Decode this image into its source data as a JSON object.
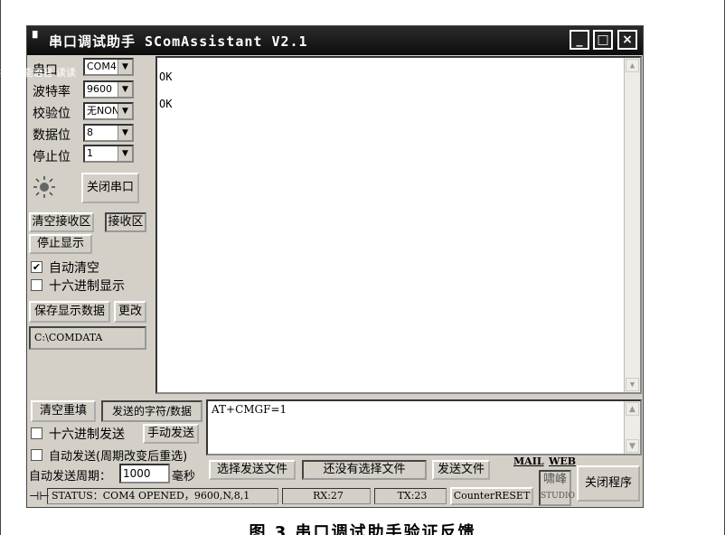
{
  "window": {
    "title": "串口调试助手 SComAssistant V2.1",
    "min_label": "_",
    "max_label": "□",
    "close_label": "×"
  },
  "overlay_text": "扳 智能语音   读读",
  "settings": {
    "port": {
      "label": "串口",
      "value": "COM4"
    },
    "baud": {
      "label": "波特率",
      "value": "9600"
    },
    "parity": {
      "label": "校验位",
      "value": "无NON"
    },
    "databits": {
      "label": "数据位",
      "value": "8"
    },
    "stopbits": {
      "label": "停止位",
      "value": "1"
    }
  },
  "close_port_label": "关闭串口",
  "clear_receive_label": "清空接收区",
  "receive_area_label": "接收区",
  "stop_display_label": "停止显示",
  "auto_clear_label": "自动清空",
  "hex_display_label": "十六进制显示",
  "save_data_label": "保存显示数据",
  "change_label": "更改",
  "save_path": "C:\\COMDATA",
  "receive_lines": [
    "OK",
    "OK"
  ],
  "clear_send_label": "清空重填",
  "send_chars_label": "发送的字符/数据",
  "send_text": "AT+CMGF=1",
  "hex_send_label": "十六进制发送",
  "manual_send_label": "手动发送",
  "auto_send_label": "自动发送(周期改变后重选)",
  "auto_period_label": "自动发送周期：",
  "auto_period_value": "1000",
  "ms_label": "毫秒",
  "select_file_label": "选择发送文件",
  "no_file_label": "还没有选择文件",
  "send_file_label": "发送文件",
  "mail_label": "MAIL",
  "web_label": "WEB",
  "logo_text": "啸峰",
  "studio_text": "STUDIO",
  "exit_label": "关闭程序",
  "status": {
    "text": "STATUS：COM4 OPENED，9600,N,8,1",
    "rx": "RX:27",
    "tx": "TX:23",
    "reset": "CounterRESET"
  },
  "caption": "图 3   串口调试助手验证反馈",
  "colors": {
    "face": "#d4d0c8",
    "titlebar": "#111111"
  }
}
